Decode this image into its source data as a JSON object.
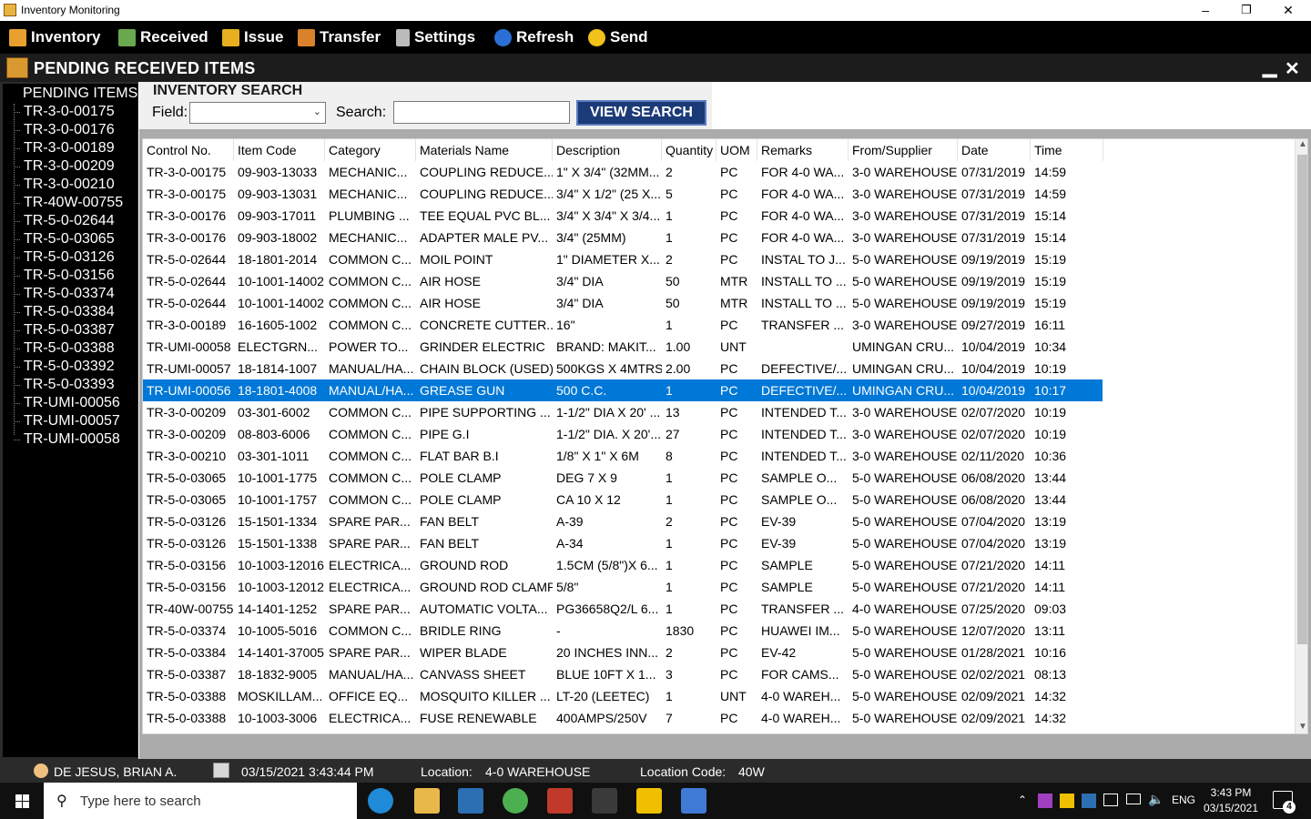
{
  "window": {
    "title": "Inventory Monitoring",
    "minimize": "–",
    "restore": "❐",
    "close": "✕"
  },
  "menu": [
    {
      "label": "Inventory",
      "icon": "inventory-icon",
      "color": "#e8a030"
    },
    {
      "label": "Received",
      "icon": "received-icon",
      "color": "#6aa84f"
    },
    {
      "label": "Issue",
      "icon": "issue-icon",
      "color": "#e8b020"
    },
    {
      "label": "Transfer",
      "icon": "transfer-icon",
      "color": "#d9822b"
    },
    {
      "label": "Settings",
      "icon": "lock-icon",
      "color": "#bbbbbb"
    },
    {
      "label": "Refresh",
      "icon": "refresh-icon",
      "color": "#2b6fd6"
    },
    {
      "label": "Send",
      "icon": "send-icon",
      "color": "#f2c21a"
    }
  ],
  "subheader": {
    "title": "PENDING RECEIVED ITEMS",
    "minimize": "▁",
    "close": "✕"
  },
  "tree": {
    "root": "PENDING ITEMS",
    "items": [
      "TR-3-0-00175",
      "TR-3-0-00176",
      "TR-3-0-00189",
      "TR-3-0-00209",
      "TR-3-0-00210",
      "TR-40W-00755",
      "TR-5-0-02644",
      "TR-5-0-03065",
      "TR-5-0-03126",
      "TR-5-0-03156",
      "TR-5-0-03374",
      "TR-5-0-03384",
      "TR-5-0-03387",
      "TR-5-0-03388",
      "TR-5-0-03392",
      "TR-5-0-03393",
      "TR-UMI-00056",
      "TR-UMI-00057",
      "TR-UMI-00058"
    ]
  },
  "search": {
    "title": "INVENTORY SEARCH",
    "field_label": "Field:",
    "field_value": "",
    "search_label": "Search:",
    "search_value": "",
    "button": "VIEW SEARCH"
  },
  "table": {
    "columns": [
      "Control No.",
      "Item Code",
      "Category",
      "Materials Name",
      "Description",
      "Quantity",
      "UOM",
      "Remarks",
      "From/Supplier",
      "Date",
      "Time"
    ],
    "selected_index": 10,
    "rows": [
      [
        "TR-3-0-00175",
        "09-903-13033",
        "MECHANIC...",
        "COUPLING REDUCE...",
        "1\" X 3/4\" (32MM...",
        "2",
        "PC",
        "FOR 4-0 WA...",
        "3-0 WAREHOUSE",
        "07/31/2019",
        "14:59"
      ],
      [
        "TR-3-0-00175",
        "09-903-13031",
        "MECHANIC...",
        "COUPLING REDUCE...",
        "3/4\" X 1/2\" (25 X...",
        "5",
        "PC",
        "FOR 4-0 WA...",
        "3-0 WAREHOUSE",
        "07/31/2019",
        "14:59"
      ],
      [
        "TR-3-0-00176",
        "09-903-17011",
        "PLUMBING ...",
        "TEE EQUAL PVC BL...",
        "3/4\" X 3/4\" X 3/4...",
        "1",
        "PC",
        "FOR 4-0 WA...",
        "3-0 WAREHOUSE",
        "07/31/2019",
        "15:14"
      ],
      [
        "TR-3-0-00176",
        "09-903-18002",
        "MECHANIC...",
        "ADAPTER MALE PV...",
        "3/4\" (25MM)",
        "1",
        "PC",
        "FOR 4-0 WA...",
        "3-0 WAREHOUSE",
        "07/31/2019",
        "15:14"
      ],
      [
        "TR-5-0-02644",
        "18-1801-2014",
        "COMMON C...",
        "MOIL POINT",
        "1\" DIAMETER X...",
        "2",
        "PC",
        "INSTAL TO J...",
        "5-0 WAREHOUSE",
        "09/19/2019",
        "15:19"
      ],
      [
        "TR-5-0-02644",
        "10-1001-14002",
        "COMMON C...",
        "AIR HOSE",
        "3/4\" DIA",
        "50",
        "MTR",
        "INSTALL TO ...",
        "5-0 WAREHOUSE",
        "09/19/2019",
        "15:19"
      ],
      [
        "TR-5-0-02644",
        "10-1001-14002",
        "COMMON C...",
        "AIR HOSE",
        "3/4\" DIA",
        "50",
        "MTR",
        "INSTALL TO ...",
        "5-0 WAREHOUSE",
        "09/19/2019",
        "15:19"
      ],
      [
        "TR-3-0-00189",
        "16-1605-1002",
        "COMMON C...",
        "CONCRETE CUTTER...",
        "16\"",
        "1",
        "PC",
        "TRANSFER ...",
        "3-0 WAREHOUSE",
        "09/27/2019",
        "16:11"
      ],
      [
        "TR-UMI-00058",
        "ELECTGRN...",
        "POWER TO...",
        "GRINDER ELECTRIC",
        "BRAND: MAKIT...",
        "1.00",
        "UNT",
        "",
        "UMINGAN CRU...",
        "10/04/2019",
        "10:34"
      ],
      [
        "TR-UMI-00057",
        "18-1814-1007",
        "MANUAL/HA...",
        "CHAIN BLOCK (USED)",
        "500KGS X 4MTRS",
        "2.00",
        "PC",
        "DEFECTIVE/...",
        "UMINGAN CRU...",
        "10/04/2019",
        "10:19"
      ],
      [
        "TR-UMI-00056",
        "18-1801-4008",
        "MANUAL/HA...",
        "GREASE GUN",
        "500 C.C.",
        "1",
        "PC",
        "DEFECTIVE/...",
        "UMINGAN CRU...",
        "10/04/2019",
        "10:17"
      ],
      [
        "TR-3-0-00209",
        "03-301-6002",
        "COMMON C...",
        "PIPE SUPPORTING ...",
        "1-1/2\" DIA X 20' ...",
        "13",
        "PC",
        "INTENDED T...",
        "3-0 WAREHOUSE",
        "02/07/2020",
        "10:19"
      ],
      [
        "TR-3-0-00209",
        "08-803-6006",
        "COMMON C...",
        "PIPE G.I",
        "1-1/2\" DIA. X 20'...",
        "27",
        "PC",
        "INTENDED T...",
        "3-0 WAREHOUSE",
        "02/07/2020",
        "10:19"
      ],
      [
        "TR-3-0-00210",
        "03-301-1011",
        "COMMON C...",
        "FLAT BAR B.I",
        "1/8\" X 1\" X 6M",
        "8",
        "PC",
        "INTENDED T...",
        "3-0 WAREHOUSE",
        "02/11/2020",
        "10:36"
      ],
      [
        "TR-5-0-03065",
        "10-1001-1775",
        "COMMON C...",
        "POLE CLAMP",
        "DEG 7 X 9",
        "1",
        "PC",
        "SAMPLE O...",
        "5-0 WAREHOUSE",
        "06/08/2020",
        "13:44"
      ],
      [
        "TR-5-0-03065",
        "10-1001-1757",
        "COMMON C...",
        "POLE CLAMP",
        "CA 10 X 12",
        "1",
        "PC",
        "SAMPLE O...",
        "5-0 WAREHOUSE",
        "06/08/2020",
        "13:44"
      ],
      [
        "TR-5-0-03126",
        "15-1501-1334",
        "SPARE PAR...",
        "FAN BELT",
        "A-39",
        "2",
        "PC",
        "EV-39",
        "5-0 WAREHOUSE",
        "07/04/2020",
        "13:19"
      ],
      [
        "TR-5-0-03126",
        "15-1501-1338",
        "SPARE PAR...",
        "FAN BELT",
        "A-34",
        "1",
        "PC",
        "EV-39",
        "5-0 WAREHOUSE",
        "07/04/2020",
        "13:19"
      ],
      [
        "TR-5-0-03156",
        "10-1003-12016",
        "ELECTRICA...",
        "GROUND ROD",
        "1.5CM (5/8\")X 6...",
        "1",
        "PC",
        "SAMPLE",
        "5-0 WAREHOUSE",
        "07/21/2020",
        "14:11"
      ],
      [
        "TR-5-0-03156",
        "10-1003-12012",
        "ELECTRICA...",
        "GROUND ROD CLAMP",
        "5/8\"",
        "1",
        "PC",
        "SAMPLE",
        "5-0 WAREHOUSE",
        "07/21/2020",
        "14:11"
      ],
      [
        "TR-40W-00755",
        "14-1401-1252",
        "SPARE PAR...",
        "AUTOMATIC VOLTA...",
        "PG36658Q2/L 6...",
        "1",
        "PC",
        "TRANSFER ...",
        "4-0 WAREHOUSE",
        "07/25/2020",
        "09:03"
      ],
      [
        "TR-5-0-03374",
        "10-1005-5016",
        "COMMON C...",
        "BRIDLE RING",
        "-",
        "1830",
        "PC",
        "HUAWEI IM...",
        "5-0 WAREHOUSE",
        "12/07/2020",
        "13:11"
      ],
      [
        "TR-5-0-03384",
        "14-1401-37005",
        "SPARE PAR...",
        "WIPER BLADE",
        "20 INCHES INN...",
        "2",
        "PC",
        "EV-42",
        "5-0 WAREHOUSE",
        "01/28/2021",
        "10:16"
      ],
      [
        "TR-5-0-03387",
        "18-1832-9005",
        "MANUAL/HA...",
        "CANVASS SHEET",
        "BLUE 10FT X 1...",
        "3",
        "PC",
        "FOR CAMS...",
        "5-0 WAREHOUSE",
        "02/02/2021",
        "08:13"
      ],
      [
        "TR-5-0-03388",
        "MOSKILLAM...",
        "OFFICE EQ...",
        "MOSQUITO KILLER ...",
        "LT-20 (LEETEC)",
        "1",
        "UNT",
        "4-0 WAREH...",
        "5-0 WAREHOUSE",
        "02/09/2021",
        "14:32"
      ],
      [
        "TR-5-0-03388",
        "10-1003-3006",
        "ELECTRICA...",
        "FUSE RENEWABLE",
        "400AMPS/250V",
        "7",
        "PC",
        "4-0 WAREH...",
        "5-0 WAREHOUSE",
        "02/09/2021",
        "14:32"
      ]
    ]
  },
  "status": {
    "user": "DE JESUS, BRIAN A.",
    "datetime": "03/15/2021 3:43:44 PM",
    "location_label": "Location:",
    "location": "4-0 WAREHOUSE",
    "location_code_label": "Location Code:",
    "location_code": "40W"
  },
  "taskbar": {
    "search_placeholder": "Type here to search",
    "lang": "ENG",
    "time": "3:43 PM",
    "date": "03/15/2021",
    "notifications": "4"
  }
}
